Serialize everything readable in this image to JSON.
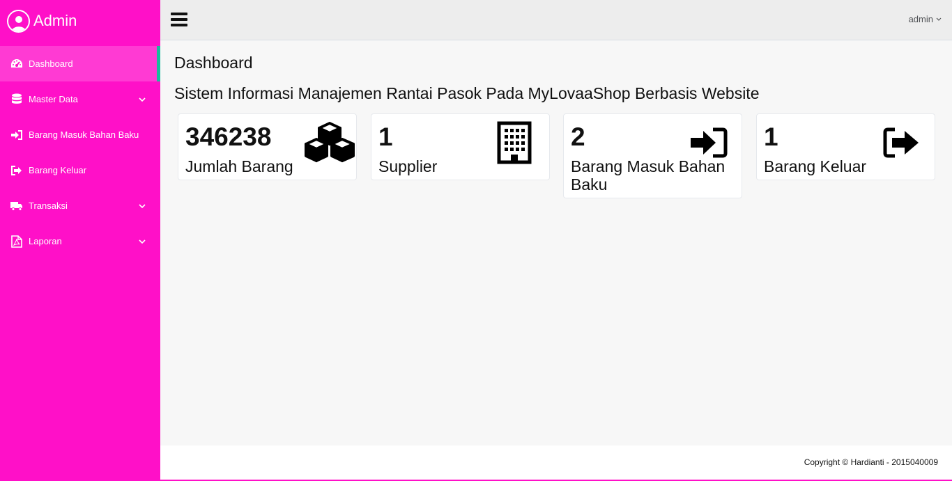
{
  "brand": {
    "title": "Admin",
    "icon": "user-avatar-icon"
  },
  "sidebar": {
    "accent_color": "#ff10c8",
    "items": [
      {
        "label": "Dashboard",
        "icon": "tachometer-icon",
        "active": true,
        "has_submenu": false
      },
      {
        "label": "Master Data",
        "icon": "database-icon",
        "active": false,
        "has_submenu": true
      },
      {
        "label": "Barang Masuk Bahan Baku",
        "icon": "sign-in-icon",
        "active": false,
        "has_submenu": false
      },
      {
        "label": "Barang Keluar",
        "icon": "sign-out-icon",
        "active": false,
        "has_submenu": false
      },
      {
        "label": "Transaksi",
        "icon": "truck-icon",
        "active": false,
        "has_submenu": true
      },
      {
        "label": "Laporan",
        "icon": "pdf-file-icon",
        "active": false,
        "has_submenu": true
      }
    ]
  },
  "topbar": {
    "user": "admin"
  },
  "main": {
    "page_title": "Dashboard",
    "subtitle": "Sistem Informasi Manajemen Rantai Pasok Pada MyLovaaShop Berbasis Website"
  },
  "cards": [
    {
      "count": "346238",
      "label": "Jumlah Barang",
      "icon": "cubes-icon"
    },
    {
      "count": "1",
      "label": "Supplier",
      "icon": "building-icon"
    },
    {
      "count": "2",
      "label": "Barang Masuk Bahan Baku",
      "icon": "sign-in-icon"
    },
    {
      "count": "1",
      "label": "Barang Keluar",
      "icon": "sign-out-icon"
    }
  ],
  "footer": {
    "text": "Copyright © Hardianti - 2015040009"
  }
}
